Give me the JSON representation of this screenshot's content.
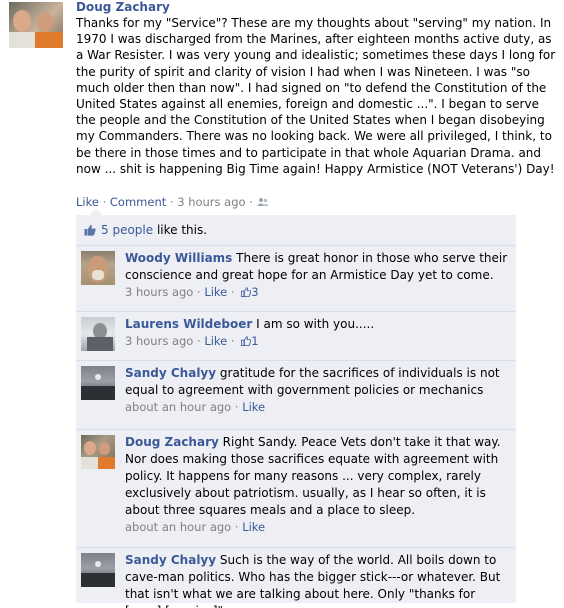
{
  "post": {
    "author": "Doug Zachary",
    "text": "Thanks for my \"Service\"? These are my thoughts about \"serving\" my nation. In 1970 I was discharged from the Marines, after eighteen months active duty, as a War Resister. I was very young and idealistic; sometimes these days I long for the purity of spirit and clarity of vision I had when I was Nineteen. I was \"so much older then than now\". I had signed on \"to defend the Constitution of the United States against all enemies, foreign and domestic ...\". I began to serve the people and the Constitution of the United States when I began disobeying my Commanders. There was no looking back. We were all privileged, I think, to be there in those times and to participate in that whole Aquarian Drama. and now ... shit is happening Big Time again! Happy Armistice (NOT Veterans') Day!",
    "like_label": "Like",
    "comment_label": "Comment",
    "time": "3 hours ago",
    "sep": "·",
    "audience_icon": "friends-icon"
  },
  "likes": {
    "count_text": "5 people",
    "suffix": " like this.",
    "icon": "thumbs-up-icon"
  },
  "comments": [
    {
      "author": "Woody Williams",
      "text": "There is great honor in those who serve their conscience and great hope for an Armistice Day yet to come.",
      "time": "3 hours ago",
      "like_label": "Like",
      "likes": "3"
    },
    {
      "author": "Laurens Wildeboer",
      "text": "I am so with you.....",
      "time": "3 hours ago",
      "like_label": "Like",
      "likes": "1"
    },
    {
      "author": "Sandy Chalyy",
      "text": "gratitude for the sacrifices of individuals is not equal to agreement with government policies or mechanics",
      "time": "about an hour ago",
      "like_label": "Like"
    },
    {
      "author": "Doug Zachary",
      "text": "Right Sandy. Peace Vets don't take it that way. Nor does making those sacrifices equate with agreement with policy. It happens for many reasons ... very complex, rarely exclusively about patriotism. usually, as I hear so often, it is about three squares meals and a place to sleep.",
      "time": "about an hour ago",
      "like_label": "Like"
    },
    {
      "author": "Sandy Chalyy",
      "text": "Such is the way of the world. All boils down to cave-man politics. Who has the bigger stick---or whatever. But that isn't what we are talking about here. Only \"thanks for [your] [service]\"",
      "time": "",
      "like_label": ""
    }
  ],
  "colors": {
    "link": "#3b5998",
    "meta": "#808080",
    "comment_bg": "#edeff4",
    "divider": "#d8dfea"
  }
}
